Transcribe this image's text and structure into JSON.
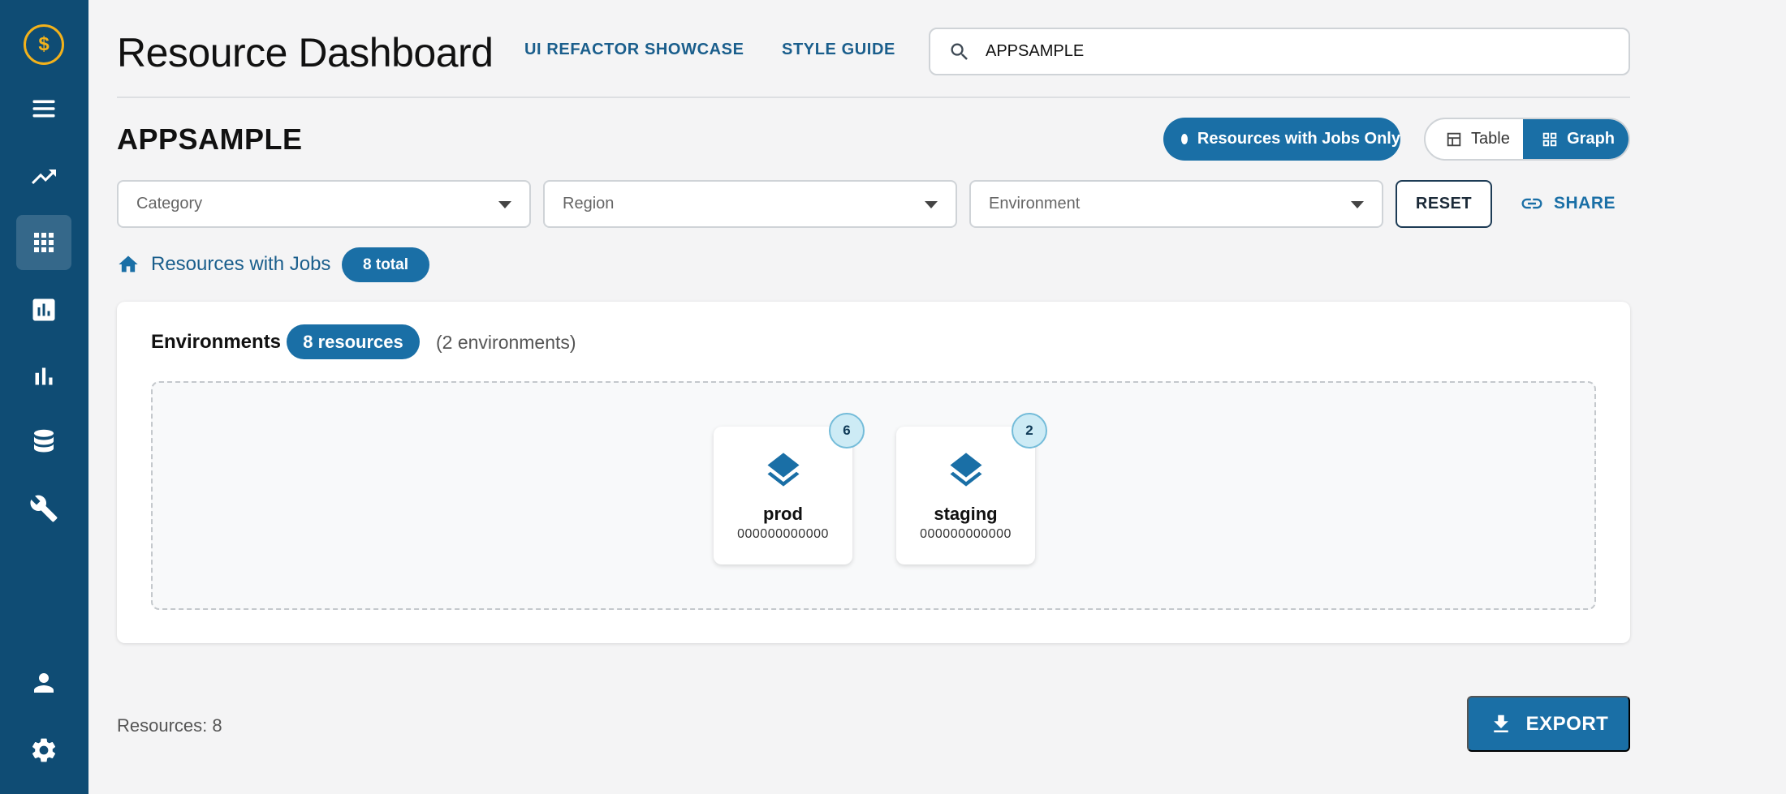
{
  "app": {
    "title": "Resource Dashboard",
    "logo_symbol": "$",
    "accent_color": "#1a6fa6",
    "sidebar_color": "#0f4c74"
  },
  "header": {
    "nav_links": [
      "UI REFACTOR SHOWCASE",
      "STYLE GUIDE"
    ],
    "search": {
      "value": "APPSAMPLE",
      "icon": "search-icon"
    }
  },
  "sidebar": {
    "items": [
      {
        "name": "menu",
        "icon": "hamburger-icon",
        "active": false
      },
      {
        "name": "trends",
        "icon": "trending-up-icon",
        "active": false
      },
      {
        "name": "apps",
        "icon": "grid-icon",
        "active": true
      },
      {
        "name": "reports",
        "icon": "report-chart-icon",
        "active": false
      },
      {
        "name": "analytics",
        "icon": "bar-chart-icon",
        "active": false
      },
      {
        "name": "database",
        "icon": "database-icon",
        "active": false
      },
      {
        "name": "tools",
        "icon": "wrench-icon",
        "active": false
      },
      {
        "name": "profile",
        "icon": "user-icon",
        "active": false
      },
      {
        "name": "settings",
        "icon": "gear-icon",
        "active": false
      }
    ]
  },
  "section": {
    "title": "APPSAMPLE",
    "jobs_toggle_label": "Resources with Jobs Only",
    "view_modes": {
      "table": "Table",
      "graph": "Graph",
      "selected": "Graph"
    }
  },
  "filters": {
    "category_placeholder": "Category",
    "region_placeholder": "Region",
    "environment_placeholder": "Environment",
    "reset_label": "RESET",
    "share_label": "SHARE"
  },
  "breadcrumb": {
    "label": "Resources with Jobs",
    "total_badge": "8 total"
  },
  "environments": {
    "label": "Environments",
    "resources_badge": "8 resources",
    "count_text": "(2 environments)",
    "nodes": [
      {
        "name": "prod",
        "id": "000000000000",
        "count": "6"
      },
      {
        "name": "staging",
        "id": "000000000000",
        "count": "2"
      }
    ]
  },
  "footer": {
    "resources_count": "Resources: 8",
    "export_label": "EXPORT"
  }
}
